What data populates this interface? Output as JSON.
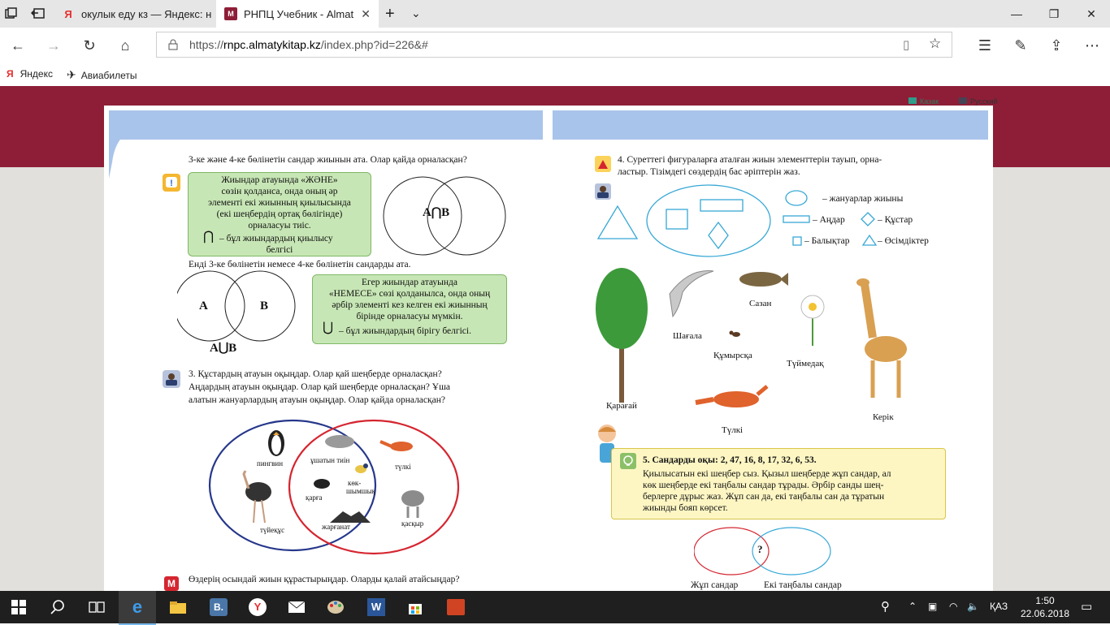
{
  "browser": {
    "tabs": [
      {
        "label": "окулык еду кз — Яндекс: н"
      },
      {
        "label": "РНПЦ Учебник - Almat"
      }
    ],
    "url_prefix": "https://",
    "url_domain": "rnpc.almatykitap.kz",
    "url_path": "/index.php?id=226&#",
    "bookmarks": [
      {
        "label": "Яндекс",
        "icon": "yandex-icon"
      },
      {
        "label": "Авиабилеты",
        "icon": "plane-icon"
      }
    ]
  },
  "site": {
    "languages": [
      "Казак",
      "Русский"
    ]
  },
  "left_page": {
    "line1": "3-ке және 4-ке бөлінетін сандар жиынын ата. Олар қайда орналасқан?",
    "rule1": [
      "Жиындар атауында «ЖӘНЕ»",
      "сөзін қолданса, онда оның әр",
      "элементі екі жиынның қиылысында",
      "(екі шеңбердің ортақ бөлігінде)",
      "орналасуы тиіс."
    ],
    "rule1_symbol": "⋂",
    "rule1_symbol_text": [
      "– бұл жиындардың қиылысу",
      "белгісі"
    ],
    "venn1_label": "A⋂B",
    "line2": "Енді 3-ке бөлінетін немесе 4-ке бөлінетін сандарды ата.",
    "venn2_a": "A",
    "venn2_b": "B",
    "venn2_label": "A⋃B",
    "rule2": [
      "Егер жиындар атауында",
      "«НЕМЕСЕ» сөзі қолданылса, онда оның",
      "әрбір элементі кез келген екі жиынның",
      "бірінде орналасуы мүмкін."
    ],
    "rule2_symbol": "⋃",
    "rule2_symbol_text": "– бұл жиындардың бірігу белгісі.",
    "task3": [
      "3. Құстардың атауын оқыңдар. Олар қай шеңберде орналасқан?",
      "Аңдардың атауын оқыңдар. Олар қай шеңберде орналасқан? Ұша",
      "алатын жануарлардың атауын оқыңдар. Олар қайда орналасқан?"
    ],
    "animals": {
      "penguin": "пингвин",
      "squirrel": "ұшатын тиін",
      "fox": "түлкі",
      "ostrich": "түйеқұс",
      "crow": "қарға",
      "tit": "көк-",
      "tit2": "шымшық",
      "wolf": "қасқыр",
      "bat": "жарғанат"
    },
    "footer": "Өздерің осындай жиын құрастырыңдар. Оларды қалай атайсыңдар?"
  },
  "right_page": {
    "task4": [
      "4. Суреттегі фигураларға аталған жиын элементтерін тауып, орна-",
      "ластыр. Тізімдегі сөздердің бас әріптерін жаз."
    ],
    "legend": {
      "animals": "– жануарлар жиыны",
      "beasts": "– Аңдар",
      "birds": "– Құстар",
      "fish": "– Балықтар",
      "plants": "– Өсімдіктер"
    },
    "labels": {
      "seagull": "Шағала",
      "carp": "Сазан",
      "ant": "Құмырсқа",
      "daisy": "Түймедақ",
      "pine": "Қарағай",
      "fox": "Түлкі",
      "giraffe": "Керік"
    },
    "task5_title": "5. Сандарды оқы: 2, 47, 16, 8, 17, 32, 6, 53.",
    "task5": [
      "Қиылысатын екі шеңбер сыз. Қызыл шеңберде жұп сандар, ал",
      "көк шеңберде екі таңбалы сандар тұрады. Әрбір санды шең-",
      "берлерге дұрыс жаз. Жұп сан да, екі таңбалы сан да тұратын",
      "жиынды бояп көрсет."
    ],
    "question_mark": "?",
    "venn_even": "Жұп сандар",
    "venn_twodigit": "Екі таңбалы сандар"
  },
  "taskbar": {
    "lang": "ҚАЗ",
    "time": "1:50",
    "date": "22.06.2018"
  }
}
